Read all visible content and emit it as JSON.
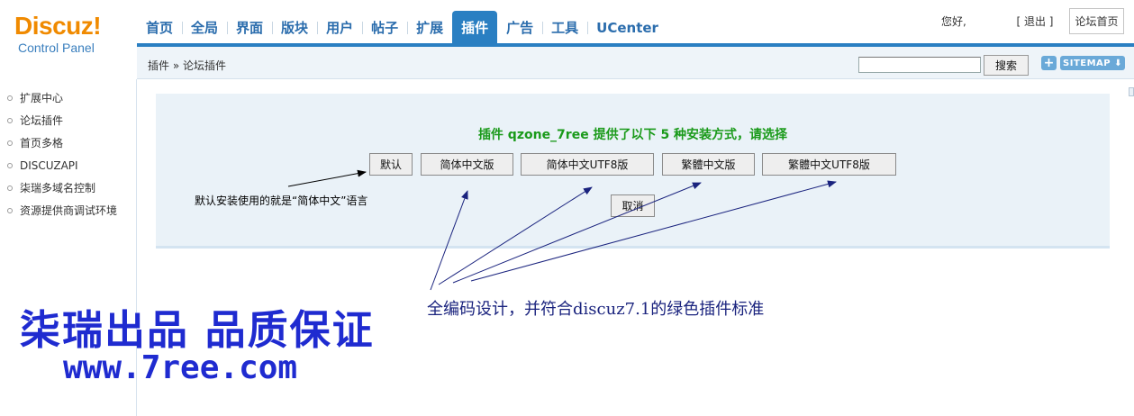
{
  "logo": {
    "main": "Discuz!",
    "sub": "Control Panel"
  },
  "nav": {
    "items": [
      {
        "label": "首页"
      },
      {
        "label": "全局"
      },
      {
        "label": "界面"
      },
      {
        "label": "版块"
      },
      {
        "label": "用户"
      },
      {
        "label": "帖子"
      },
      {
        "label": "扩展"
      },
      {
        "label": "插件"
      },
      {
        "label": "广告"
      },
      {
        "label": "工具"
      },
      {
        "label": "UCenter"
      }
    ],
    "active": "插件"
  },
  "user": {
    "greeting": "您好,",
    "logout": "[ 退出 ]",
    "home": "论坛首页"
  },
  "breadcrumb": {
    "text": "插件 » 论坛插件"
  },
  "search": {
    "value": "",
    "button": "搜索"
  },
  "toolbar": {
    "plus": "+",
    "sitemap": "SITEMAP ⬇"
  },
  "sidebar": {
    "items": [
      {
        "label": "扩展中心"
      },
      {
        "label": "论坛插件"
      },
      {
        "label": "首页多格"
      },
      {
        "label": "DISCUZAPI"
      },
      {
        "label": "柒瑞多域名控制"
      },
      {
        "label": "资源提供商调试环境"
      }
    ]
  },
  "install": {
    "title": "插件 qzone_7ree 提供了以下 5 种安装方式，请选择",
    "options": [
      {
        "label": "默认"
      },
      {
        "label": "简体中文版"
      },
      {
        "label": "简体中文UTF8版"
      },
      {
        "label": "繁體中文版"
      },
      {
        "label": "繁體中文UTF8版"
      }
    ],
    "cancel": "取消"
  },
  "annotations": {
    "default_note": "默认安装使用的就是“简体中文”语言",
    "encoding_note": "全编码设计，并符合discuz7.1的绿色插件标准",
    "promo_line1": "柒瑞出品 品质保证",
    "promo_line2": "www.7ree.com"
  },
  "colors": {
    "nav_blue": "#2a7fc2",
    "logo_orange": "#f08a00",
    "title_green": "#1a9a1a",
    "promo_blue": "#1f2bd0"
  }
}
